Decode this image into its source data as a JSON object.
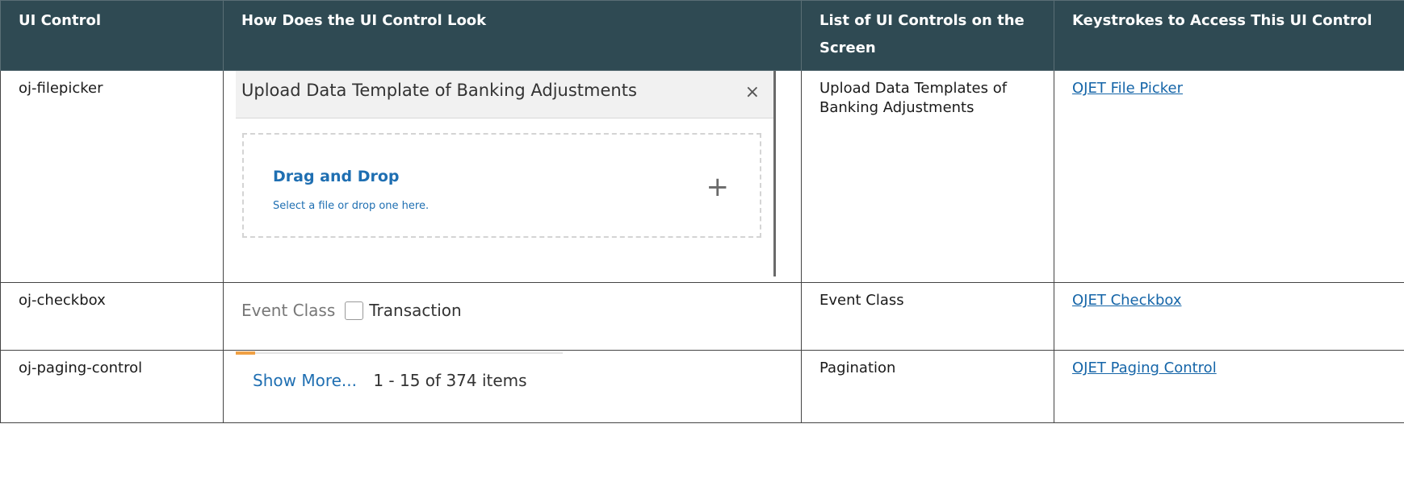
{
  "headers": [
    "UI Control",
    "How Does the UI Control Look",
    "List of UI Controls on the Screen",
    "Keystrokes to Access This UI Control"
  ],
  "rows": [
    {
      "control": "oj-filepicker",
      "screens": "Upload Data Templates of Banking Adjustments",
      "link": "OJET File Picker",
      "preview": {
        "title": "Upload Data Template of Banking Adjustments",
        "close": "×",
        "drop_title": "Drag and Drop",
        "drop_hint": "Select a file or drop one here.",
        "plus": "+"
      }
    },
    {
      "control": "oj-checkbox",
      "screens": "Event Class",
      "link": "OJET Checkbox",
      "preview": {
        "label": "Event Class",
        "option": "Transaction"
      }
    },
    {
      "control": "oj-paging-control",
      "screens": "Pagination",
      "link": "OJET Paging Control",
      "preview": {
        "show_more": "Show More...",
        "range": "1 - 15 of 374 items"
      }
    }
  ]
}
